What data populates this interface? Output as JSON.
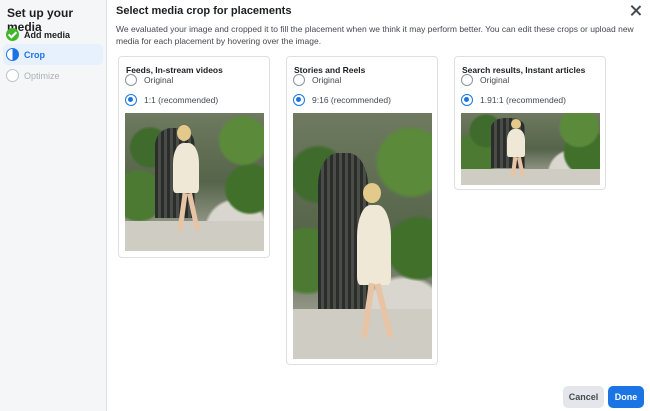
{
  "sidebar": {
    "title": "Set up your media",
    "steps": [
      {
        "label": "Add media",
        "icon": "check-circle-icon",
        "state": "complete"
      },
      {
        "label": "Crop",
        "icon": "half-circle-icon",
        "state": "active"
      },
      {
        "label": "Optimize",
        "icon": "empty-circle-icon",
        "state": "disabled"
      }
    ]
  },
  "main": {
    "title": "Select media crop for placements",
    "description": "We evaluated your image and cropped it to fill the placement when we think it may perform better. You can edit these crops or upload new media for each placement by hovering over the image.",
    "close_icon": "close-icon"
  },
  "placements": [
    {
      "title": "Feeds, In-stream videos",
      "original_label": "Original",
      "recommended_label": "1:1 (recommended)",
      "selected": "recommended"
    },
    {
      "title": "Stories and Reels",
      "original_label": "Original",
      "recommended_label": "9:16 (recommended)",
      "selected": "recommended"
    },
    {
      "title": "Search results, Instant articles",
      "original_label": "Original",
      "recommended_label": "1.91:1 (recommended)",
      "selected": "recommended"
    }
  ],
  "footer": {
    "cancel_label": "Cancel",
    "done_label": "Done"
  },
  "colors": {
    "accent": "#1b74e4",
    "success": "#42b72a",
    "sidebar_bg": "#f5f6f7",
    "active_step_bg": "#e7f0fd"
  }
}
